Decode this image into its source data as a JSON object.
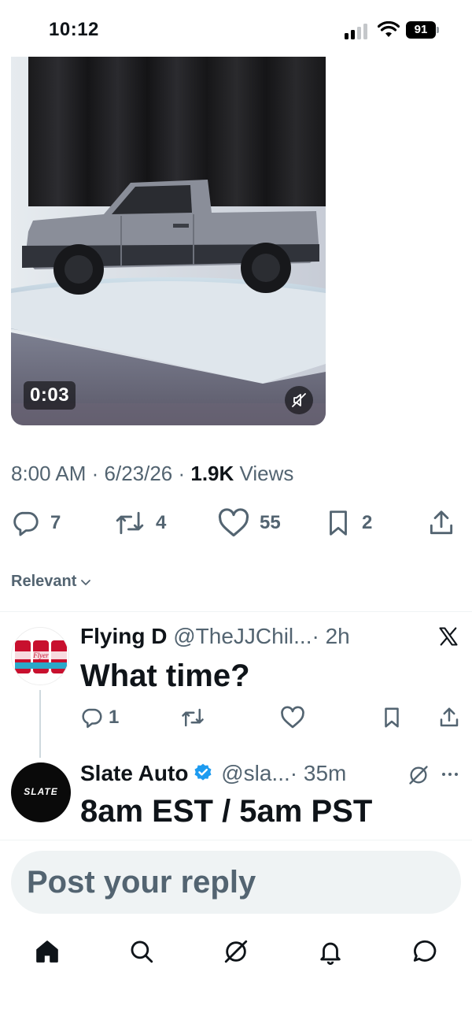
{
  "status_bar": {
    "time": "10:12",
    "battery": "91"
  },
  "video": {
    "duration": "0:03"
  },
  "tweet": {
    "time": "8:00 AM",
    "date": "6/23/26",
    "views_count": "1.9K",
    "views_label": "Views"
  },
  "actions": {
    "replies": "7",
    "reposts": "4",
    "likes": "55",
    "bookmarks": "2"
  },
  "sort": {
    "label": "Relevant"
  },
  "replies": [
    {
      "display_name": "Flying D",
      "handle": "@TheJJChil...",
      "time": "· 2h",
      "text": "What time?",
      "reply_count": "1",
      "avatar_text": "Flyer"
    },
    {
      "display_name": "Slate Auto",
      "handle": "@sla...",
      "time": "· 35m",
      "text": "8am EST / 5am PST",
      "avatar_text": "SLATE"
    }
  ],
  "compose": {
    "placeholder": "Post your reply"
  },
  "colors": {
    "text": "#0f1419",
    "muted": "#536471",
    "verified": "#1d9bf0",
    "compose_bg": "#eff3f4"
  },
  "icons": [
    "reply-icon",
    "repost-icon",
    "like-icon",
    "bookmark-icon",
    "share-icon",
    "chevron-down-icon",
    "x-logo-icon",
    "grok-icon",
    "more-icon",
    "home-icon",
    "search-icon",
    "notifications-icon",
    "messages-icon"
  ]
}
